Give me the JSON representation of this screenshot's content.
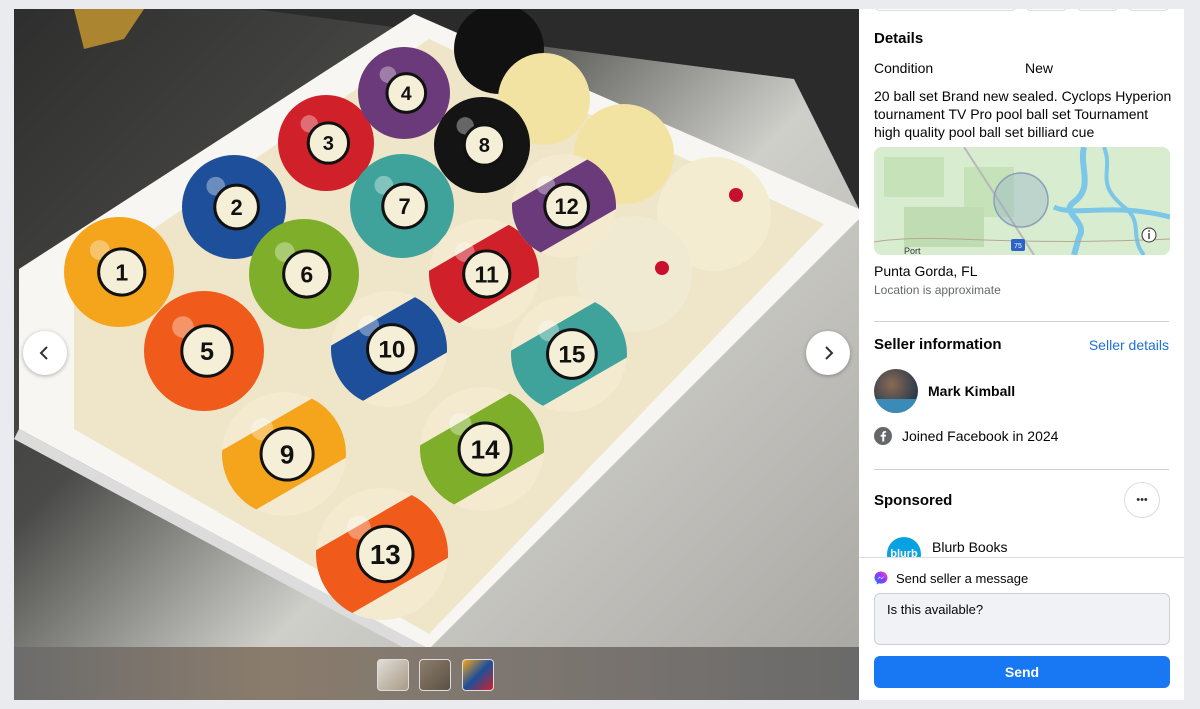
{
  "details": {
    "heading": "Details",
    "condition_label": "Condition",
    "condition_value": "New",
    "description": "20 ball set Brand new sealed. Cyclops Hyperion tournament TV Pro pool ball set Tournament high quality pool ball set billiard cue"
  },
  "map": {
    "label_port": "Port",
    "highway": "75"
  },
  "location": {
    "city": "Punta Gorda, FL",
    "note": "Location is approximate"
  },
  "seller": {
    "heading": "Seller information",
    "details_link": "Seller details",
    "name": "Mark Kimball",
    "joined": "Joined Facebook in 2024"
  },
  "sponsored": {
    "heading": "Sponsored",
    "more": "•••",
    "advertiser": "Blurb Books",
    "logo_text": "blurb"
  },
  "message": {
    "heading": "Send seller a message",
    "input_value": "Is this available?",
    "send_label": "Send"
  },
  "balls": [
    {
      "n": "1",
      "color": "#f5a51c",
      "stripe": false
    },
    {
      "n": "2",
      "color": "#1d4f9a",
      "stripe": false
    },
    {
      "n": "3",
      "color": "#d0202a",
      "stripe": false
    },
    {
      "n": "4",
      "color": "#6a3a7a",
      "stripe": false
    },
    {
      "n": "5",
      "color": "#f05a1a",
      "stripe": false
    },
    {
      "n": "6",
      "color": "#7fae2a",
      "stripe": false
    },
    {
      "n": "7",
      "color": "#3fa39c",
      "stripe": false
    },
    {
      "n": "8",
      "color": "#141414",
      "stripe": false
    },
    {
      "n": "9",
      "color": "#f5a51c",
      "stripe": true
    },
    {
      "n": "10",
      "color": "#1d4f9a",
      "stripe": true
    },
    {
      "n": "11",
      "color": "#d0202a",
      "stripe": true
    },
    {
      "n": "12",
      "color": "#6a3a7a",
      "stripe": true
    },
    {
      "n": "13",
      "color": "#f05a1a",
      "stripe": true
    },
    {
      "n": "14",
      "color": "#7fae2a",
      "stripe": true
    },
    {
      "n": "15",
      "color": "#3fa39c",
      "stripe": true
    }
  ]
}
